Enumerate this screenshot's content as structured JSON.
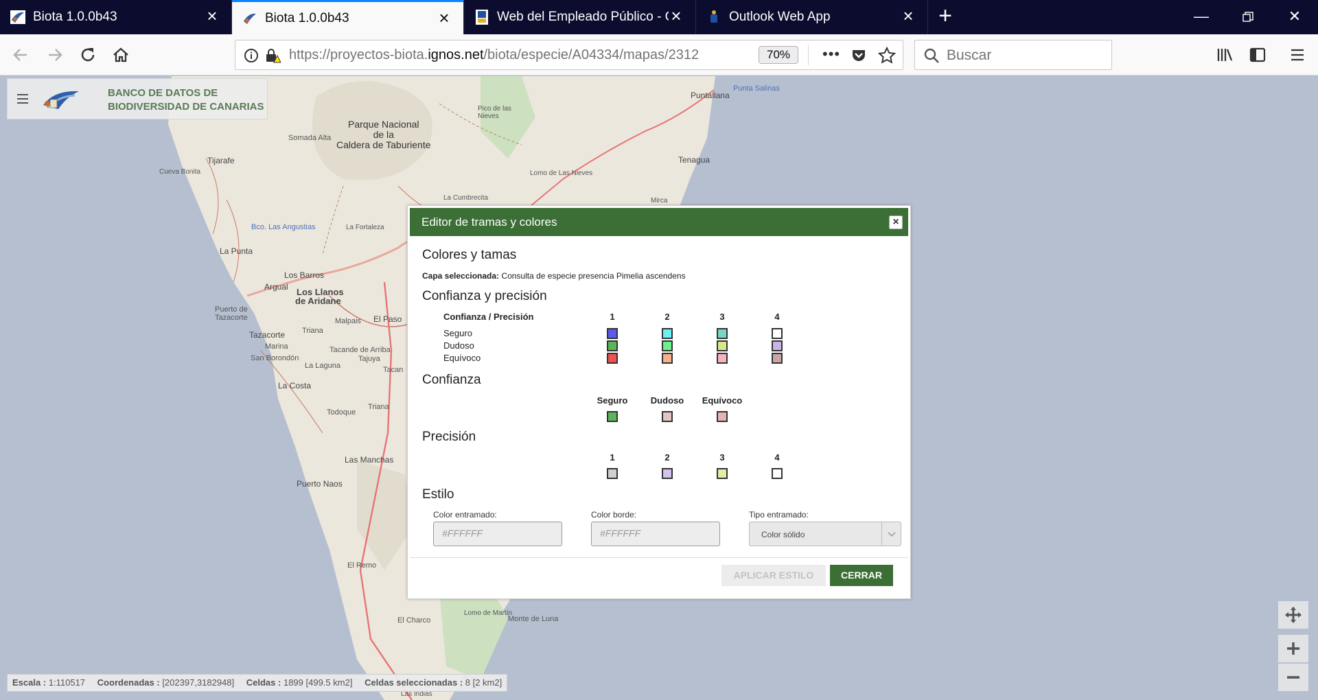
{
  "browser": {
    "tabs": [
      {
        "title": "Biota 1.0.0b43",
        "active": false
      },
      {
        "title": "Biota 1.0.0b43",
        "active": true
      },
      {
        "title": "Web del Empleado Público - Go",
        "active": false
      },
      {
        "title": "Outlook Web App",
        "active": false
      }
    ],
    "url_prefix": "https://proyectos-biota.",
    "url_domain": "ignos.net",
    "url_path": "/biota/especie/A04334/mapas/2312",
    "zoom": "70%",
    "search_placeholder": "Buscar"
  },
  "app": {
    "title_line1": "BANCO DE DATOS DE",
    "title_line2": "BIODIVERSIDAD DE CANARIAS"
  },
  "map_labels": {
    "park": [
      "Parque Nacional",
      "de la",
      "Caldera de Taburiente"
    ],
    "places": [
      "Puntallana",
      "Punta Salinas",
      "Pico de las Nieves",
      "Somada Alta",
      "Tijarafe",
      "Cueva Bonita",
      "Tenagua",
      "Lomo de Las Nieves",
      "La Cumbrecita",
      "Mirca",
      "Bco. Las Angustias",
      "La Fortaleza",
      "La Punta",
      "Los Barros",
      "Argual",
      "Los Llanos",
      "de Aridane",
      "Puerto de",
      "Tazacorte",
      "Malpais",
      "El Paso",
      "Tazacorte",
      "Triana",
      "Marina",
      "Tacande de Arriba",
      "San Borondón",
      "Tajuya",
      "La Laguna",
      "Tacan",
      "La Costa",
      "Todoque",
      "Triana",
      "Las Manchas",
      "Puerto Naos",
      "El Remo",
      "El Charco",
      "Lomo de Martín",
      "Monte de Luna",
      "Las Indias"
    ]
  },
  "dialog": {
    "title": "Editor de tramas y colores",
    "section_colors": "Colores y tamas",
    "selected_layer_label": "Capa seleccionada:",
    "selected_layer_value": "Consulta de especie presencia Pimelia ascendens",
    "section_conf_prec": "Confianza y precisión",
    "matrix_header": "Confianza / Precisión",
    "matrix_cols": [
      "1",
      "2",
      "3",
      "4"
    ],
    "matrix_rows": [
      {
        "label": "Seguro",
        "swatches": [
          "#5a5af0",
          "#6ff0f0",
          "#7ad6c6",
          "#ffffff"
        ]
      },
      {
        "label": "Dudoso",
        "swatches": [
          "#5bb55b",
          "#6ef08a",
          "#d6e88a",
          "#c8b4e6"
        ]
      },
      {
        "label": "Equívoco",
        "swatches": [
          "#f05050",
          "#f7b08a",
          "#f8b4bc",
          "#c9a6a6"
        ]
      }
    ],
    "section_conf": "Confianza",
    "conf_cols": [
      {
        "label": "Seguro",
        "color": "#5bb55b"
      },
      {
        "label": "Dudoso",
        "color": "#e2c4c4"
      },
      {
        "label": "Equívoco",
        "color": "#e6b4b4"
      }
    ],
    "section_prec": "Precisión",
    "prec_cols": [
      {
        "label": "1",
        "color": "#cfcfcf"
      },
      {
        "label": "2",
        "color": "#d2c2ec"
      },
      {
        "label": "3",
        "color": "#e4eca8"
      },
      {
        "label": "4",
        "color": "#ffffff"
      }
    ],
    "section_style": "Estilo",
    "fill_color_label": "Color entramado:",
    "fill_color_placeholder": "#FFFFFF",
    "border_color_label": "Color borde:",
    "border_color_placeholder": "#FFFFFF",
    "fill_type_label": "Tipo entramado:",
    "fill_type_value": "Color sólido",
    "apply_button": "APLICAR ESTILO",
    "close_button": "CERRAR"
  },
  "status": {
    "scale_label": "Escala :",
    "scale_value": "1:110517",
    "coords_label": "Coordenadas :",
    "coords_value": "[202397,3182948]",
    "cells_label": "Celdas :",
    "cells_value": "1899 [499.5 km2]",
    "selected_cells_label": "Celdas seleccionadas :",
    "selected_cells_value": "8 [2 km2]"
  },
  "colors": {
    "accent_green": "#3b6f35",
    "tabbar": "#0c0c2f",
    "sea": "#b6bfd0",
    "land": "#ece7dd"
  }
}
